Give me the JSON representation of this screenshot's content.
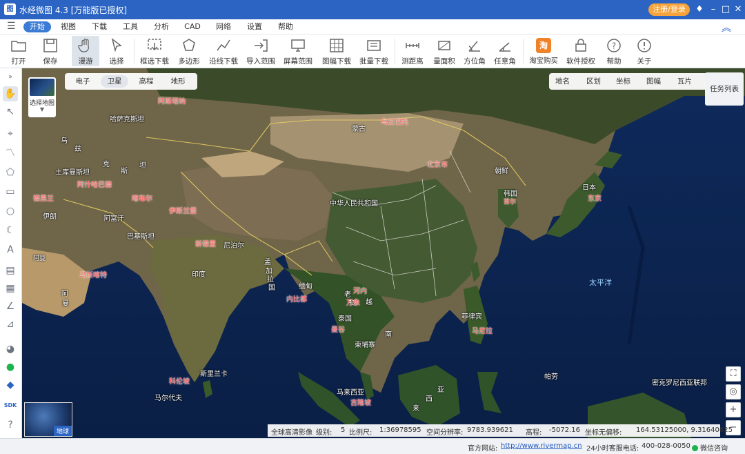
{
  "window": {
    "title": "水经微图 4.3 [万能版已授权]",
    "login_button": "注册/登录",
    "app_icon_glyph": "图"
  },
  "menu": {
    "items": [
      "开始",
      "视图",
      "下载",
      "工具",
      "分析",
      "CAD",
      "网络",
      "设置",
      "帮助"
    ],
    "active": "开始"
  },
  "toolbar": {
    "open": "打开",
    "save": "保存",
    "pan": "漫游",
    "select": "选择",
    "frame_download": "框选下载",
    "polygon": "多边形",
    "line_download": "沿线下载",
    "import_range": "导入范围",
    "screen_range": "屏幕范围",
    "sheet_download": "图幅下载",
    "batch_download": "批量下载",
    "measure_distance": "测距离",
    "measure_area": "量面积",
    "azimuth": "方位角",
    "any_angle": "任意角",
    "taobao": "淘宝购买",
    "license": "软件授权",
    "help": "帮助",
    "about": "关于",
    "taobao_glyph": "淘"
  },
  "map_layers": {
    "panel_label": "选择地图",
    "types": [
      "电子",
      "卫星",
      "高程",
      "地形"
    ],
    "active_type": "卫星",
    "overlays": [
      "地名",
      "区划",
      "坐标",
      "图幅",
      "瓦片"
    ],
    "task_list": "任务列表",
    "minimap_label": "地球"
  },
  "map_labels": {
    "white": [
      "哈萨克斯坦",
      "蒙古",
      "乌",
      "兹",
      "克",
      "土库曼斯坦",
      "斯",
      "坦",
      "伊朗",
      "阿富汗",
      "巴基斯坦",
      "尼泊尔",
      "中华人民共和国",
      "朝鲜",
      "韩国",
      "日本",
      "印度",
      "孟",
      "加",
      "拉",
      "国",
      "缅甸",
      "老",
      "挝",
      "泰国",
      "越",
      "南",
      "柬埔寨",
      "菲律宾",
      "马来西亚",
      "斯里兰卡",
      "马尔代夫",
      "帕劳",
      "西",
      "亚",
      "来",
      "密克罗尼西亚联邦",
      "阿",
      "曼",
      "阿曼"
    ],
    "red": [
      "阿斯塔纳",
      "乌兰巴托",
      "北京市",
      "首尔",
      "东京",
      "阿什哈巴德",
      "德黑兰",
      "喀布尔",
      "伊斯兰堡",
      "新德里",
      "马斯喀特",
      "内比都",
      "河内",
      "万象",
      "曼谷",
      "马尼拉",
      "科伦坡",
      "吉隆坡"
    ],
    "sea": [
      "太平洋"
    ]
  },
  "info": {
    "layer": "全球高清影像",
    "level_label": "级别:",
    "level": "5",
    "scale_label": "比例尺:",
    "scale": "1:36978595",
    "resolution_label": "空间分辨率:",
    "resolution": "9783.939621",
    "elevation_label": "高程:",
    "elevation": "-5072.16",
    "coord_label": "坐标无偏移:",
    "coord": "164.53125000, 9.31640625"
  },
  "status": {
    "site_label": "官方网站:",
    "site_url": "http://www.rivermap.cn",
    "phone_label": "24小时客服电话:",
    "phone": "400-028-0050",
    "chat": "微信咨询"
  },
  "colors": {
    "brand": "#2b64c2",
    "login": "#f5a33a",
    "capital_label": "#ff5a5a",
    "taobao": "#f08328"
  }
}
